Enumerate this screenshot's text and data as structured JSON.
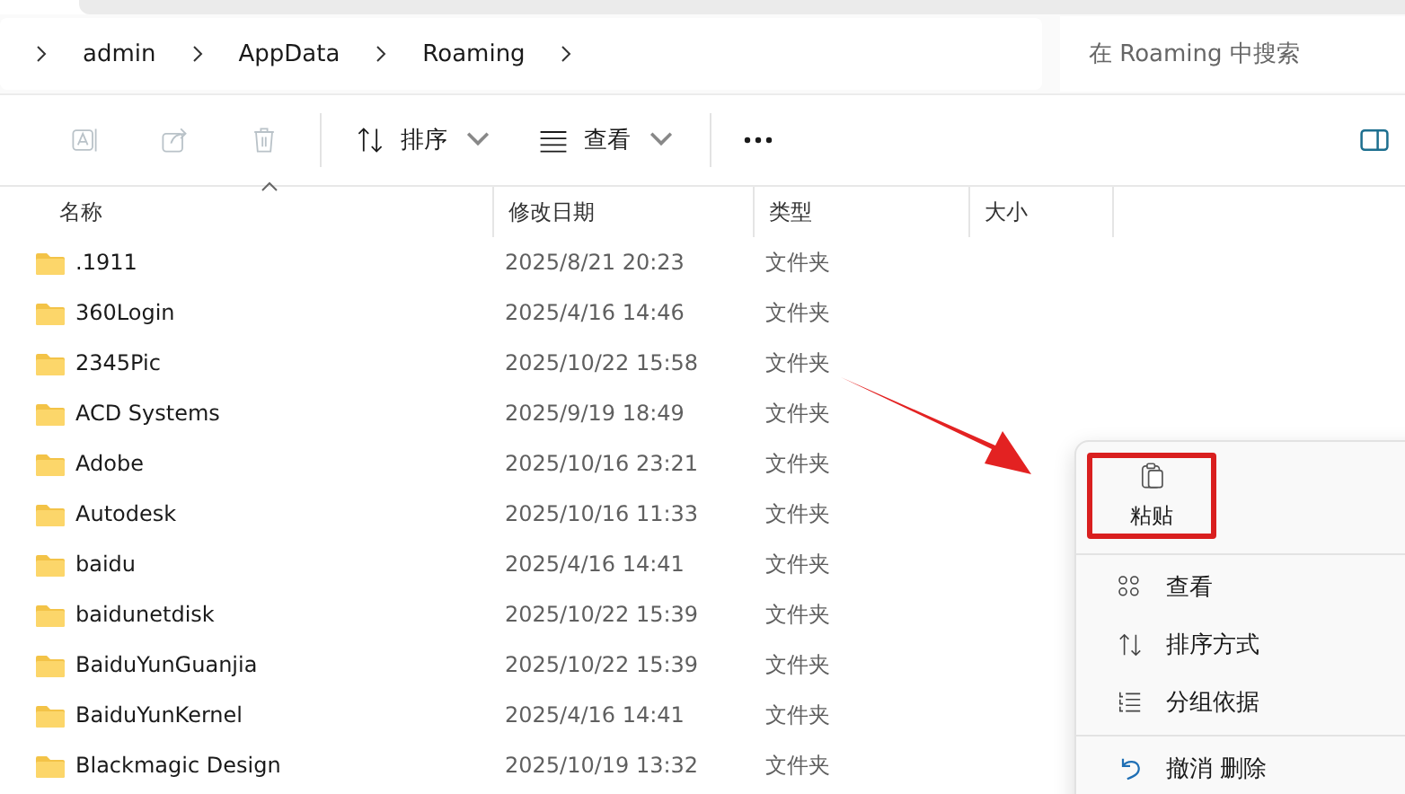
{
  "address": {
    "crumbs": [
      "admin",
      "AppData",
      "Roaming"
    ]
  },
  "search": {
    "placeholder": "在 Roaming 中搜索"
  },
  "toolbar": {
    "items": [
      {
        "kind": "rename",
        "disabled": true
      },
      {
        "kind": "share",
        "disabled": true
      },
      {
        "kind": "delete",
        "disabled": true
      },
      {
        "kind": "sort",
        "label": "排序"
      },
      {
        "kind": "view",
        "label": "查看"
      },
      {
        "kind": "more"
      }
    ]
  },
  "columns": [
    {
      "label": "名称",
      "sorted": true
    },
    {
      "label": "修改日期",
      "sorted": false
    },
    {
      "label": "类型",
      "sorted": false
    },
    {
      "label": "大小",
      "sorted": false
    }
  ],
  "rows": [
    {
      "name": ".1911",
      "date": "2025/8/21 20:23",
      "type": "文件夹"
    },
    {
      "name": "360Login",
      "date": "2025/4/16 14:46",
      "type": "文件夹"
    },
    {
      "name": "2345Pic",
      "date": "2025/10/22 15:58",
      "type": "文件夹"
    },
    {
      "name": "ACD Systems",
      "date": "2025/9/19 18:49",
      "type": "文件夹"
    },
    {
      "name": "Adobe",
      "date": "2025/10/16 23:21",
      "type": "文件夹"
    },
    {
      "name": "Autodesk",
      "date": "2025/10/16 11:33",
      "type": "文件夹"
    },
    {
      "name": "baidu",
      "date": "2025/4/16 14:41",
      "type": "文件夹"
    },
    {
      "name": "baidunetdisk",
      "date": "2025/10/22 15:39",
      "type": "文件夹"
    },
    {
      "name": "BaiduYunGuanjia",
      "date": "2025/10/22 15:39",
      "type": "文件夹"
    },
    {
      "name": "BaiduYunKernel",
      "date": "2025/4/16 14:41",
      "type": "文件夹"
    },
    {
      "name": "Blackmagic Design",
      "date": "2025/10/19 13:32",
      "type": "文件夹"
    }
  ],
  "context_menu": {
    "items": [
      {
        "kind": "paste",
        "label": "粘贴",
        "highlighted": true
      },
      {
        "kind": "view",
        "label": "查看"
      },
      {
        "kind": "sort",
        "label": "排序方式"
      },
      {
        "kind": "group",
        "label": "分组依据"
      },
      {
        "kind": "divider"
      },
      {
        "kind": "undo",
        "label": "撤消 删除"
      }
    ]
  }
}
